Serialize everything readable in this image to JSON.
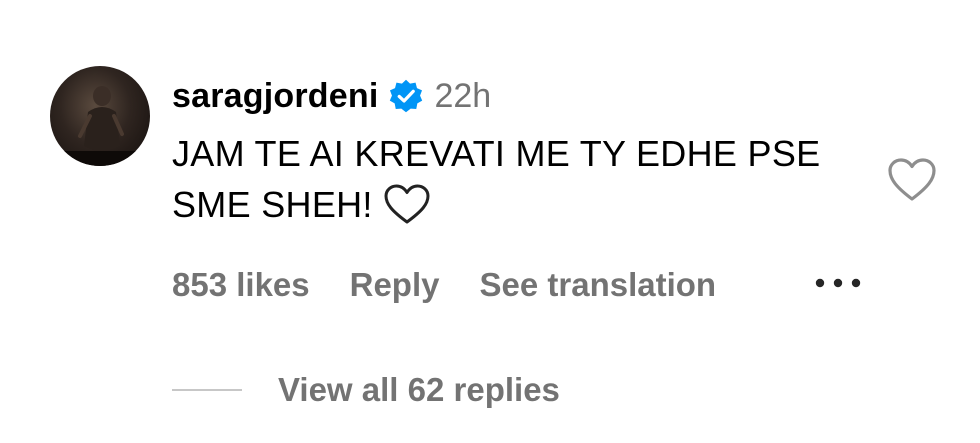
{
  "comment": {
    "username": "saragjordeni",
    "verified": true,
    "time": "22h",
    "text": "JAM TE AI KREVATI ME TY EDHE PSE SME SHEH!",
    "likes": "853 likes",
    "reply_label": "Reply",
    "translation_label": "See translation",
    "view_replies_label": "View all 62 replies"
  },
  "icons": {
    "avatar": "profile-photo",
    "verified": "verified-badge-icon",
    "inline_emoji": "white-heart-icon",
    "like": "heart-outline-icon",
    "more": "more-horizontal-icon"
  },
  "colors": {
    "verified_blue": "#0095f6",
    "secondary_text": "#737373",
    "divider": "#c7c7c7"
  }
}
